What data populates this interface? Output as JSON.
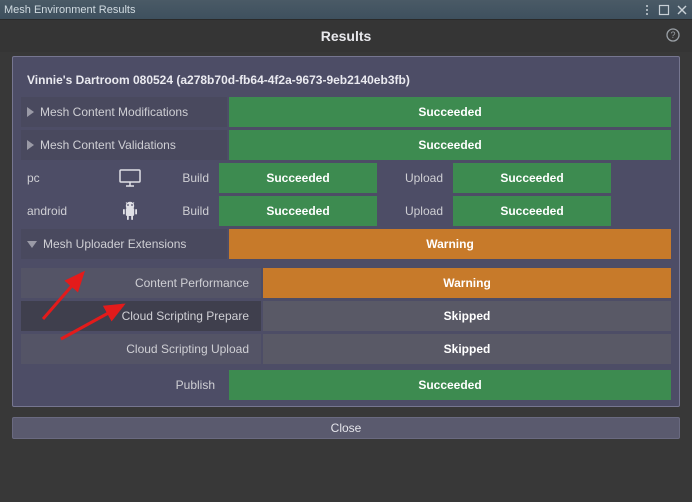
{
  "window": {
    "title": "Mesh Environment Results"
  },
  "header": {
    "title": "Results"
  },
  "project": {
    "title": "Vinnie's Dartroom 080524 (a278b70d-fb64-4f2a-9673-9eb2140eb3fb)"
  },
  "summary": [
    {
      "label": "Mesh Content Modifications",
      "status": "Succeeded",
      "color": "green",
      "expanded": false
    },
    {
      "label": "Mesh Content Validations",
      "status": "Succeeded",
      "color": "green",
      "expanded": false
    }
  ],
  "platforms": {
    "build_label": "Build",
    "upload_label": "Upload",
    "rows": [
      {
        "name": "pc",
        "icon": "monitor",
        "build": {
          "status": "Succeeded",
          "color": "green"
        },
        "upload": {
          "status": "Succeeded",
          "color": "green"
        }
      },
      {
        "name": "android",
        "icon": "android",
        "build": {
          "status": "Succeeded",
          "color": "green"
        },
        "upload": {
          "status": "Succeeded",
          "color": "green"
        }
      }
    ]
  },
  "extensions": {
    "label": "Mesh Uploader Extensions",
    "status": "Warning",
    "color": "orange",
    "expanded": true,
    "items": [
      {
        "label": "Content Performance",
        "status": "Warning",
        "color": "orange"
      },
      {
        "label": "Cloud Scripting Prepare",
        "status": "Skipped",
        "color": "grey"
      },
      {
        "label": "Cloud Scripting Upload",
        "status": "Skipped",
        "color": "grey"
      }
    ]
  },
  "publish": {
    "label": "Publish",
    "status": "Succeeded",
    "color": "green"
  },
  "footer": {
    "close": "Close"
  }
}
